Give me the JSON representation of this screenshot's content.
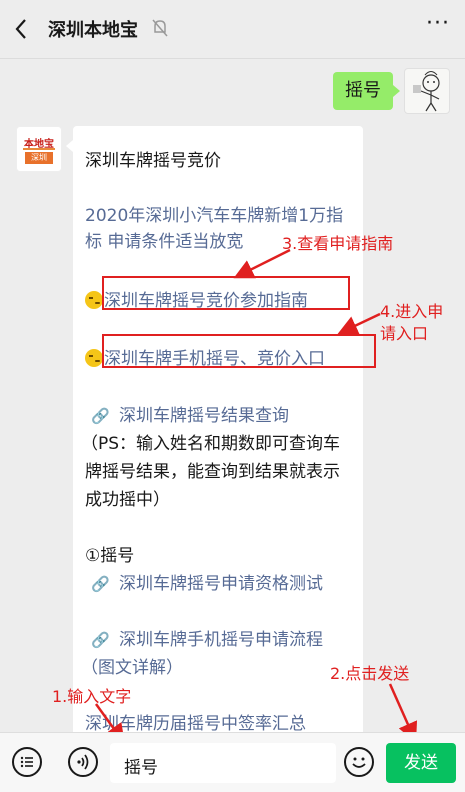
{
  "header": {
    "title": "深圳本地宝",
    "more_label": "···"
  },
  "chat": {
    "outgoing_text": "摇号",
    "incoming": {
      "logo_text": "本地宝",
      "logo_sub": "深圳",
      "heading": "深圳车牌摇号竞价",
      "news_line1": "2020年深圳小汽车车牌新增1万指",
      "news_line2": "标 申请条件适当放宽",
      "guide_link": "深圳车牌摇号竞价参加指南",
      "entry_link": "深圳车牌手机摇号、竞价入口",
      "result_link": "深圳车牌摇号结果查询",
      "ps_line1": "（PS：输入姓名和期数即可查询车",
      "ps_line2": "牌摇号结果，能查询到结果就表示",
      "ps_line3": "成功摇中）",
      "section_title": "①摇号",
      "qualify_link": "深圳车牌摇号申请资格测试",
      "process_link": "深圳车牌手机摇号申请流程",
      "process_note": "（图文详解）",
      "history_line": "深圳车牌历届摇号中签率汇总"
    }
  },
  "annotations": {
    "step1": "1.输入文字",
    "step2": "2.点击发送",
    "step3": "3.查看申请指南",
    "step4_line1": "4.进入申",
    "step4_line2": "请入口"
  },
  "input_bar": {
    "text": "摇号",
    "send_label": "发送"
  }
}
